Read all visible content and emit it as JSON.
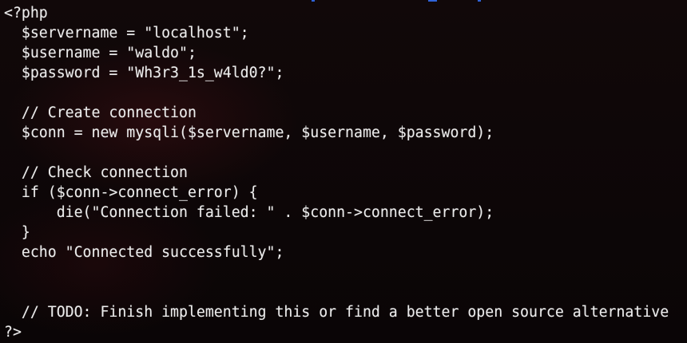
{
  "editor": {
    "lines": [
      "<?php",
      "  $servername = \"localhost\";",
      "  $username = \"waldo\";",
      "  $password = \"Wh3r3_1s_w4ld0?\";",
      "",
      "  // Create connection",
      "  $conn = new mysqli($servername, $username, $password);",
      "",
      "  // Check connection",
      "  if ($conn->connect_error) {",
      "      die(\"Connection failed: \" . $conn->connect_error);",
      "  }",
      "  echo \"Connected successfully\";",
      "",
      "",
      "  // TODO: Finish implementing this or find a better open source alternative",
      "?>"
    ]
  },
  "colors": {
    "background": "#0c0607",
    "text": "#ececec",
    "accent": "#2f63d8"
  }
}
